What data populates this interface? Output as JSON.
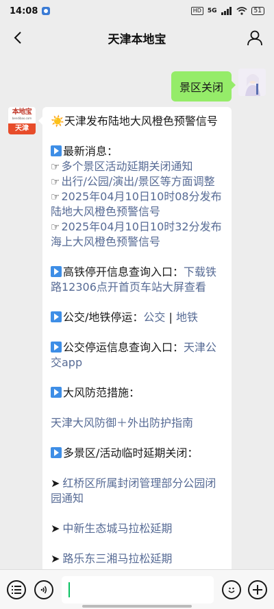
{
  "status_bar": {
    "time": "14:08",
    "hd_label": "HD",
    "network_label": "5G",
    "battery_level": "51",
    "icons": [
      "notification-icon",
      "hd-icon",
      "signal-icon",
      "wifi-icon",
      "battery-icon"
    ]
  },
  "header": {
    "title": "天津本地宝",
    "back_icon": "chevron-left-icon",
    "profile_icon": "person-icon"
  },
  "outgoing_message": {
    "text": "景区关闭"
  },
  "bot": {
    "avatar_name": "本地宝",
    "avatar_url": "bendibao.com",
    "avatar_city": "天津"
  },
  "reply": {
    "headline_emoji": "☀️",
    "headline": "天津发布陆地大风橙色预警信号",
    "latest_heading": "最新消息：",
    "latest_items": [
      "多个景区活动延期关闭通知",
      "出行/公园/演出/景区等方面调整",
      "2025年04月10日10时08分发布陆地大风橙色预警信号",
      "2025年04月10日10时32分发布海上大风橙色预警信号"
    ],
    "rail_label": "高铁停开信息查询入口：",
    "rail_link": "下载铁路12306点开首页车站大屏查看",
    "transit_label": "公交/地铁停运：",
    "transit_link_bus": "公交",
    "transit_sep": " | ",
    "transit_link_metro": "地铁",
    "bus_query_label": "公交停运信息查询入口：",
    "bus_query_link": "天津公交app",
    "wind_heading": "大风防范措施：",
    "wind_link": "天津大风防御＋外出防护指南",
    "closure_heading": "多景区/活动临时延期关闭：",
    "closure_items": [
      "红桥区所属封闭管理部分公园闭园通知",
      "中新生态城马拉松延期"
    ],
    "cut_off_item": "路乐东三湘马拉松延期"
  },
  "input_bar": {
    "voice_icon": "list-icon",
    "audio_icon": "voice-icon",
    "emoji_icon": "emoji-icon",
    "plus_icon": "plus-icon",
    "draft_text": ""
  },
  "colors": {
    "outgoing_bubble": "#95ec69",
    "link": "#576b95",
    "background": "#ededed",
    "caret": "#07c160"
  }
}
